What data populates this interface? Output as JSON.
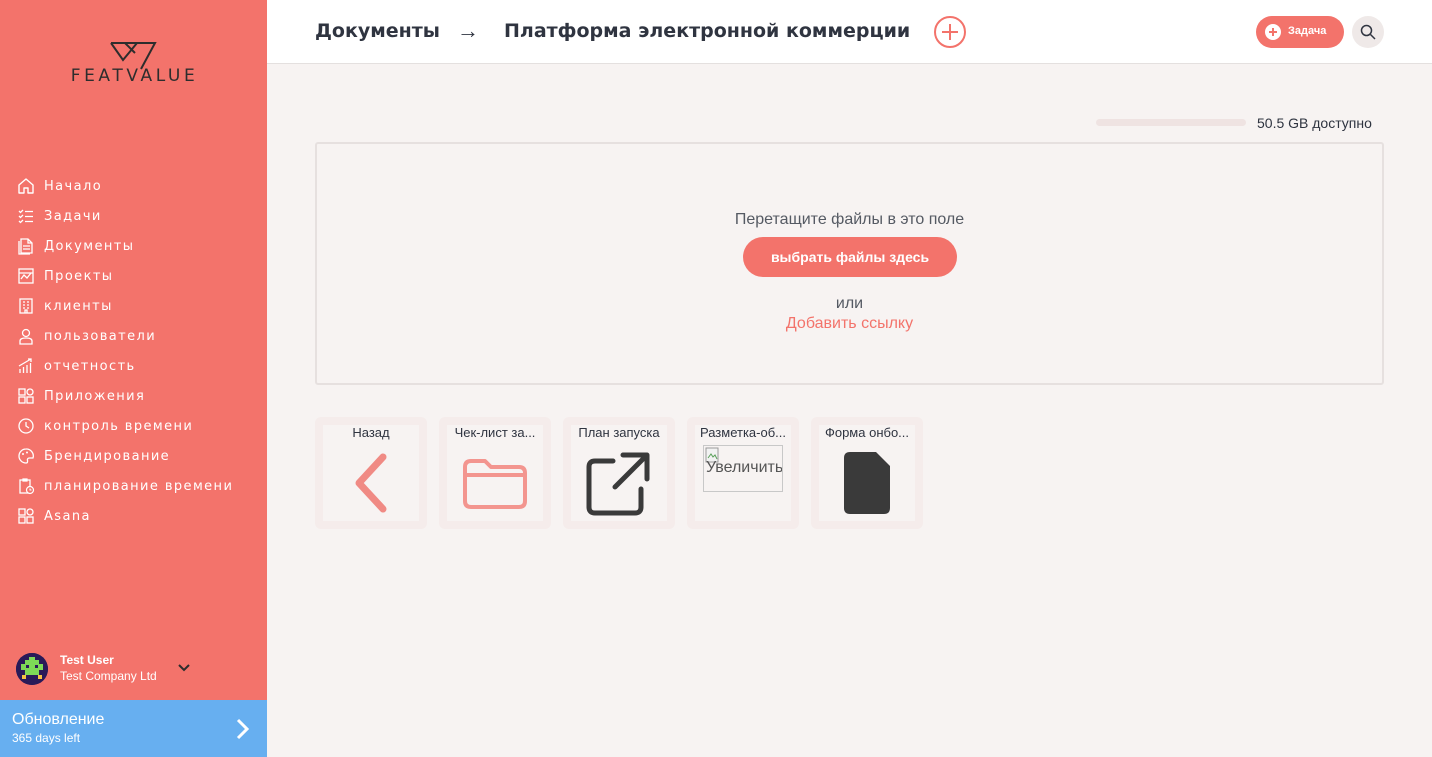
{
  "brand": {
    "logo_text": "FEATVALUE"
  },
  "sidebar": {
    "items": [
      {
        "label": "Начало",
        "icon": "home-icon"
      },
      {
        "label": "Задачи",
        "icon": "tasks-icon"
      },
      {
        "label": "Документы",
        "icon": "documents-icon"
      },
      {
        "label": "Проекты",
        "icon": "projects-icon"
      },
      {
        "label": "клиенты",
        "icon": "clients-icon"
      },
      {
        "label": "пользователи",
        "icon": "users-icon"
      },
      {
        "label": "отчетность",
        "icon": "reports-icon"
      },
      {
        "label": "Приложения",
        "icon": "apps-icon"
      },
      {
        "label": "контроль времени",
        "icon": "time-tracking-icon"
      },
      {
        "label": "Брендирование",
        "icon": "branding-icon"
      },
      {
        "label": "планирование времени",
        "icon": "time-planning-icon"
      },
      {
        "label": "Asana",
        "icon": "asana-icon"
      }
    ],
    "user": {
      "name": "Test User",
      "company": "Test Company Ltd"
    },
    "upgrade": {
      "title": "Обновление",
      "subtitle": "365 days left"
    }
  },
  "header": {
    "breadcrumb_root": "Документы",
    "breadcrumb_separator": "→",
    "breadcrumb_current": "Платформа электронной коммерции",
    "task_button": "Задача"
  },
  "storage": {
    "text": "50.5 GB доступно",
    "used_fraction": 0.0
  },
  "dropzone": {
    "hint": "Перетащите файлы в это поле",
    "button": "выбрать файлы здесь",
    "or": "или",
    "link": "Добавить ссылку"
  },
  "files": [
    {
      "label": "Назад",
      "icon": "back-chevron-icon"
    },
    {
      "label": "Чек-лист за...",
      "icon": "folder-icon"
    },
    {
      "label": "План запуска",
      "icon": "external-link-icon"
    },
    {
      "label": "Разметка-об...",
      "icon": "broken-image-icon",
      "alt": "Увеличить"
    },
    {
      "label": "Форма онбо...",
      "icon": "file-icon"
    }
  ],
  "colors": {
    "accent": "#f3736b",
    "upgrade": "#67aff0",
    "background": "#f7f3f2"
  }
}
